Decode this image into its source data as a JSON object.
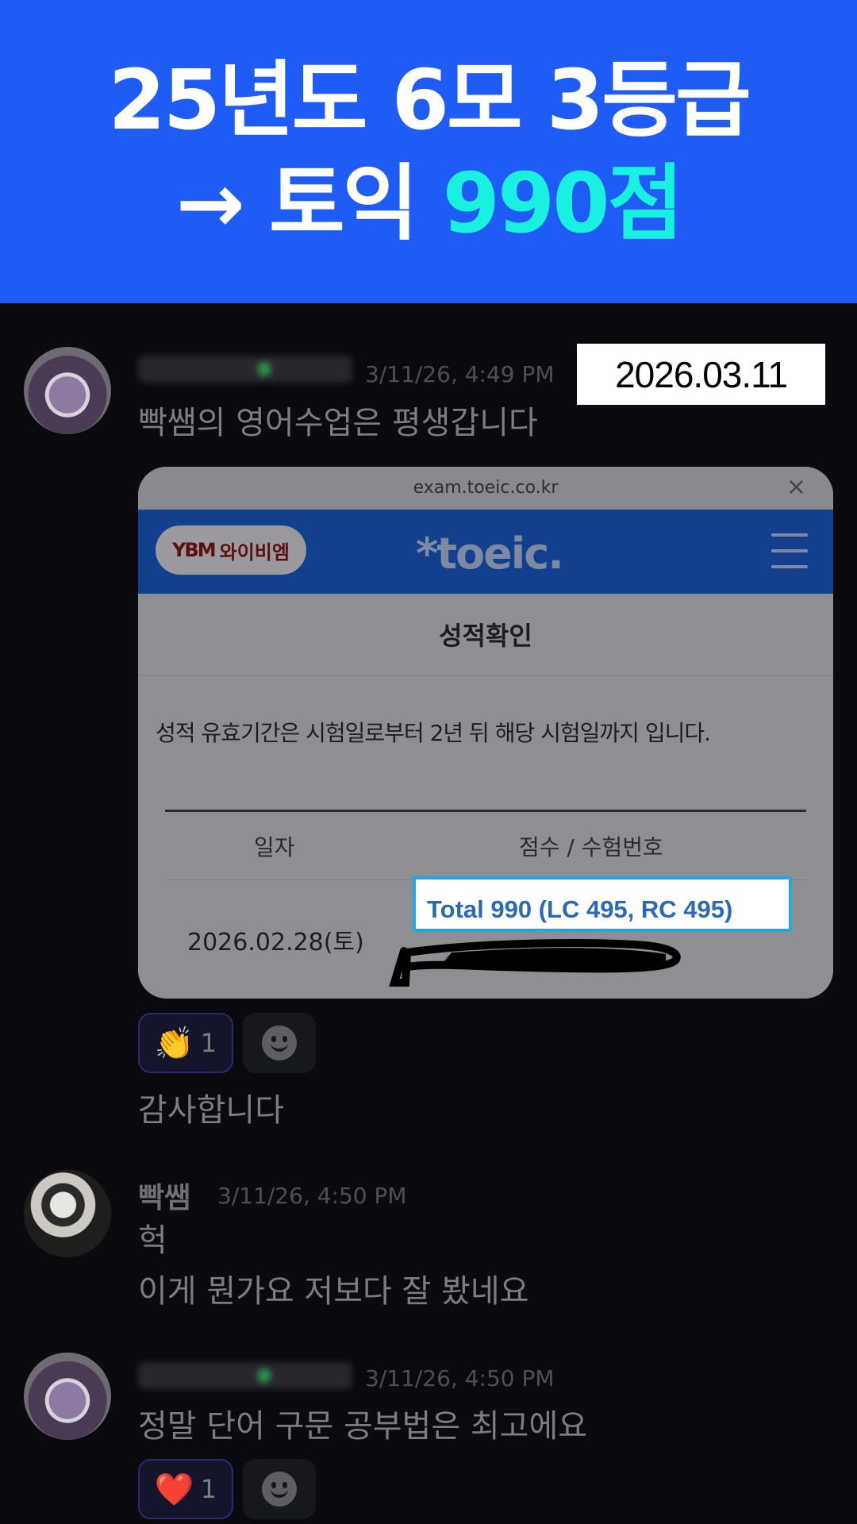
{
  "banner": {
    "line1": "25년도 6모 3등급",
    "line2_prefix": "→ 토익 ",
    "line2_accent": "990점",
    "bg_color": "#1f5cf5",
    "accent_color": "#19f0e0"
  },
  "date_badge": "2026.03.11",
  "messages": [
    {
      "timestamp": "3/11/26, 4:49 PM",
      "text": "빡쌤의 영어수업은 평생갑니다"
    },
    {
      "text": "감사합니다"
    },
    {
      "author": "빡쌤",
      "timestamp": "3/11/26, 4:50 PM",
      "line1": "헉",
      "line2": "이게 뭔가요 저보다 잘 봤네요"
    },
    {
      "timestamp": "3/11/26, 4:50 PM",
      "text": "정말 단어 구문 공부법은 최고에요"
    }
  ],
  "toeic_card": {
    "url": "exam.toeic.co.kr",
    "close": "×",
    "ybm_mark": "YBM",
    "ybm_label": "와이비엠",
    "logo": "*toeic.",
    "title": "성적확인",
    "note": "성적 유효기간은 시험일로부터 2년 뒤 해당 시험일까지 입니다.",
    "col_date": "일자",
    "col_score": "점수 / 수험번호",
    "row_date": "2026.02.28(토)",
    "row_score": "Total 990 (LC 495, RC 495)"
  },
  "reactions": [
    {
      "emoji": "👏",
      "count": "1"
    },
    {
      "emoji": "❤️",
      "count": "1"
    }
  ],
  "icons": [
    "clap-emoji",
    "add-reaction-icon",
    "heart-emoji",
    "close-icon",
    "menu-icon"
  ]
}
